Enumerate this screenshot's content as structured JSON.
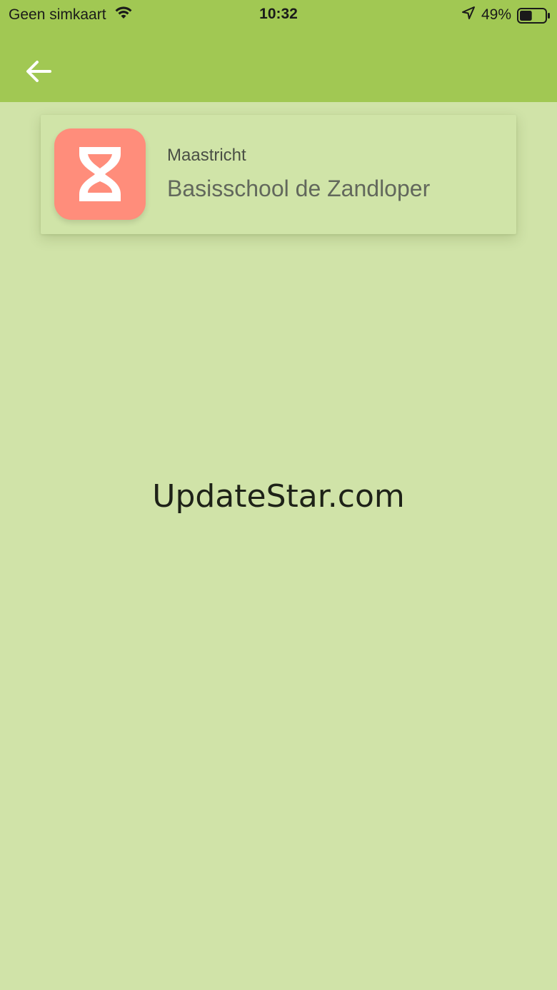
{
  "status_bar": {
    "carrier": "Geen simkaart",
    "time": "10:32",
    "battery_percent": "49%",
    "battery_level": 0.49,
    "icons": [
      "wifi-icon",
      "location-arrow-icon",
      "battery-icon"
    ]
  },
  "header": {
    "back_icon": "arrow-left-icon"
  },
  "school_card": {
    "city": "Maastricht",
    "name": "Basisschool de Zandloper",
    "logo_icon": "hourglass-icon"
  },
  "watermark": {
    "text": "UpdateStar.com"
  },
  "colors": {
    "header_bg": "#a1c853",
    "page_bg": "#d0e3a8",
    "logo_bg": "#ff8d7b"
  }
}
